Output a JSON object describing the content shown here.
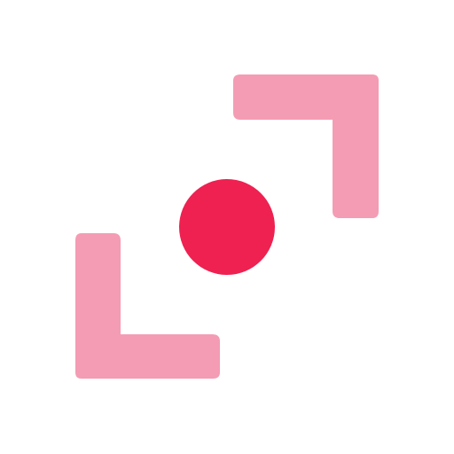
{
  "icon": {
    "name": "screen-record-icon",
    "colors": {
      "background": "#ffffff",
      "corner_brackets": "#f49cb4",
      "center_dot": "#ee2151"
    }
  }
}
